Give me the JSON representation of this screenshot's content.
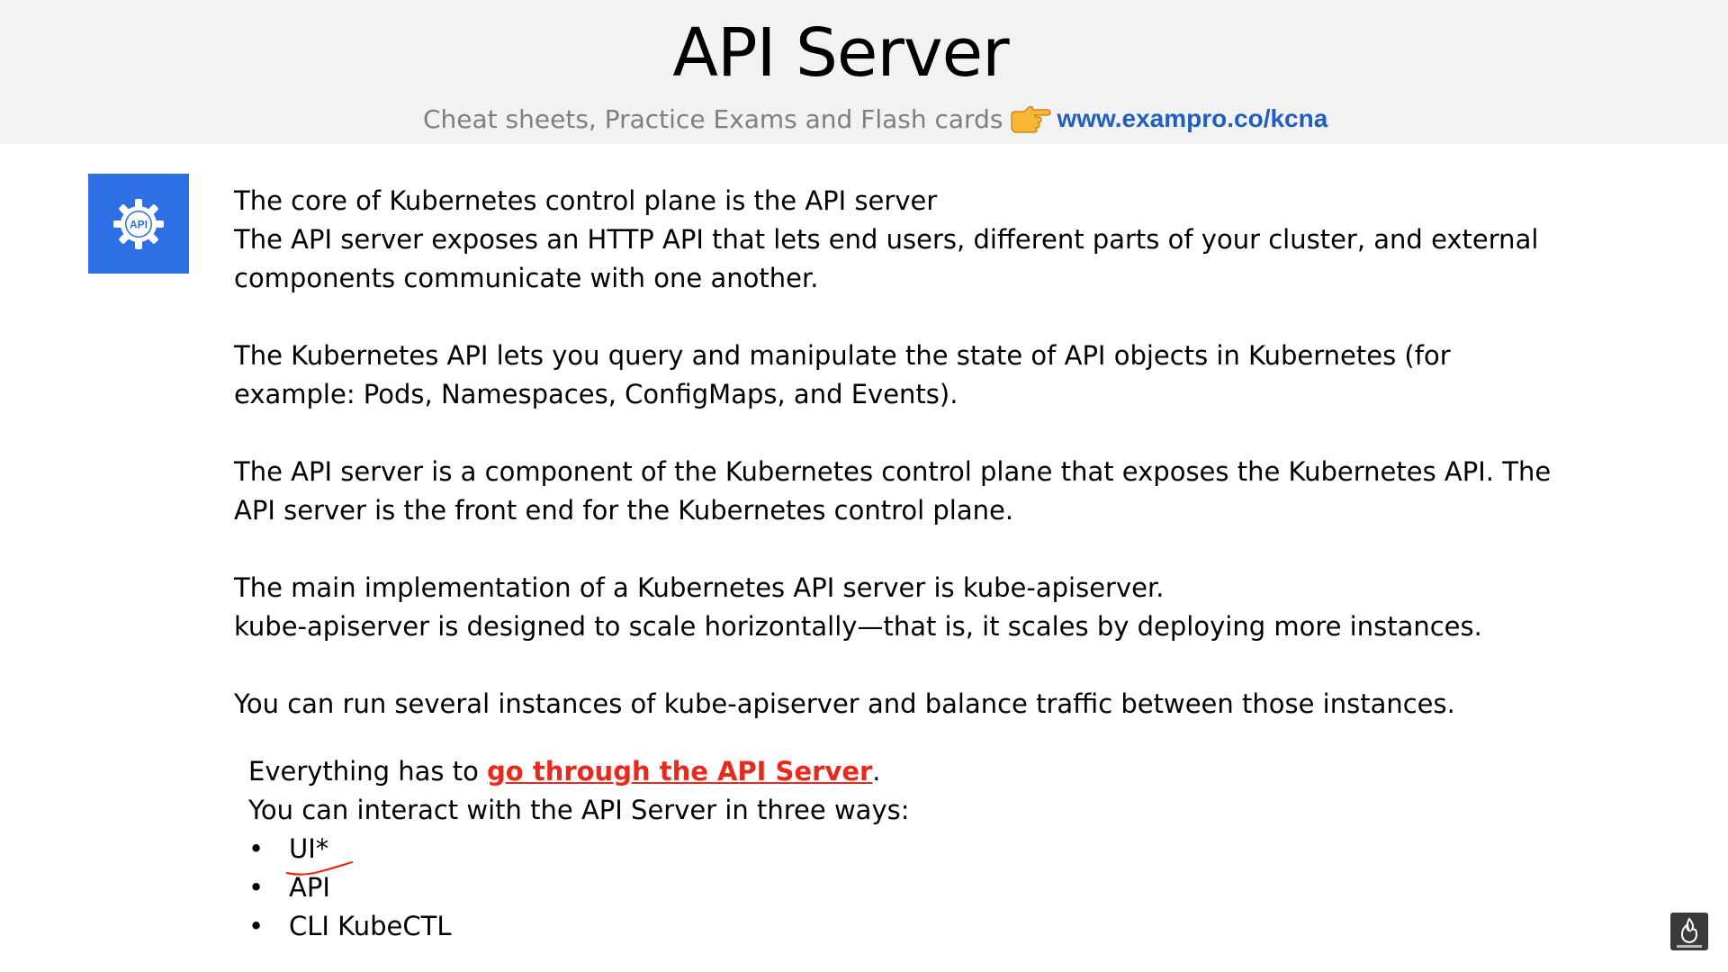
{
  "header": {
    "title": "API Server",
    "subtitle": "Cheat sheets, Practice Exams and Flash cards",
    "link": "www.exampro.co/kcna",
    "hand_icon": "pointing-hand-icon"
  },
  "tile": {
    "icon": "api-gear-icon",
    "label": "API",
    "color": "#2f6fe6"
  },
  "paragraphs": [
    [
      "The core of Kubernetes control plane is the API server",
      "The API server exposes an HTTP API that lets end users, different parts of your cluster, and external",
      "components communicate with one another."
    ],
    [
      "The Kubernetes API lets you query and manipulate the state of API objects in Kubernetes (for",
      "example: Pods, Namespaces, ConfigMaps, and Events)."
    ],
    [
      "The API server is a component of the Kubernetes control plane that exposes the Kubernetes API. The",
      "API server is the front end for the Kubernetes control plane."
    ],
    [
      "The main implementation of a Kubernetes API server is kube-apiserver.",
      "kube-apiserver is designed to scale horizontally—that is, it scales by deploying more instances."
    ],
    [
      "You can run several instances of kube-apiserver and balance traffic between those instances."
    ]
  ],
  "emphasis": {
    "prefix": "Everything has to ",
    "highlight": "go through the API Server",
    "suffix": ".",
    "highlight_color": "#e8291c"
  },
  "ways_intro": "You can interact with the API Server in three ways:",
  "ways": [
    "UI*",
    "API",
    "CLI KubeCTL"
  ],
  "annotation_color": "#e8291c",
  "corner_logo": "channel-logo-icon"
}
